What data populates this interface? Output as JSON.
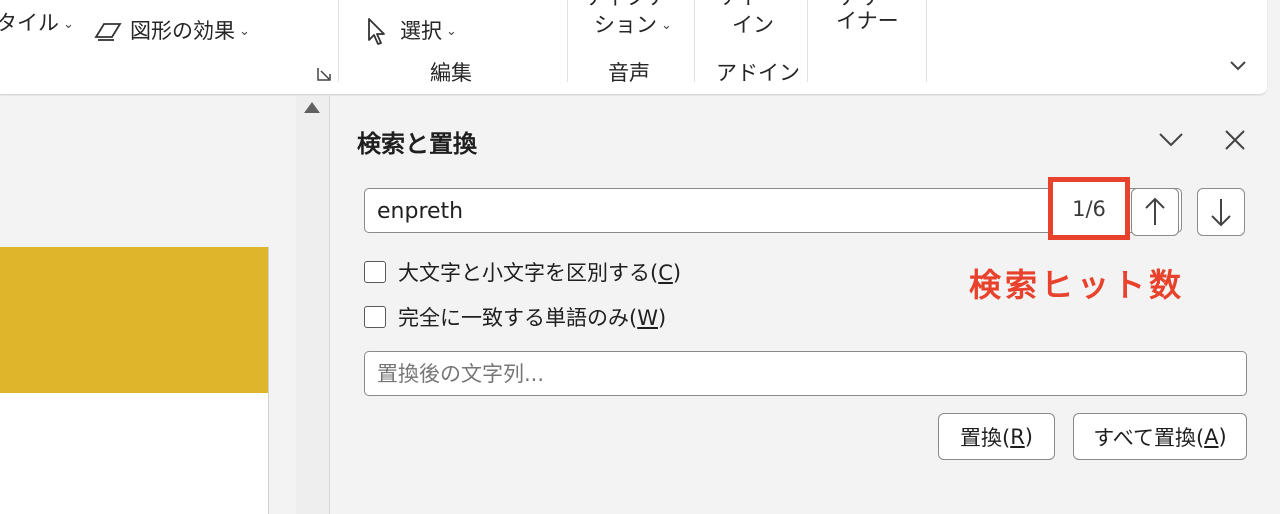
{
  "ribbon": {
    "shape_style_label": "タイル",
    "shape_effects_label": "図形の効果",
    "select_label": "選択",
    "editing_group_label": "編集",
    "dictation_top_label": "ディクテ",
    "dictation_bottom_label": "ション",
    "voice_group_label": "音声",
    "addin_top_label": "アド",
    "addin_bottom_label": "イン",
    "addin_group_label": "アドイン",
    "designer_top_label": "デザ",
    "designer_bottom_label": "イナー"
  },
  "pane": {
    "title": "検索と置換",
    "search_value": "enpreth",
    "hit_count": "1/6",
    "match_case_label": "大文字と小文字を区別する(",
    "match_case_key": "C",
    "whole_word_label": "完全に一致する単語のみ(",
    "whole_word_key": "W",
    "replace_placeholder": "置換後の文字列...",
    "replace_label": "置換(",
    "replace_key": "R",
    "replace_all_label": "すべて置換(",
    "replace_all_key": "A",
    "close_paren": ")"
  },
  "annotation": {
    "text": "検索ヒット数"
  },
  "colors": {
    "accent_red": "#e8412c",
    "slide_yellow": "#dfb52b"
  }
}
